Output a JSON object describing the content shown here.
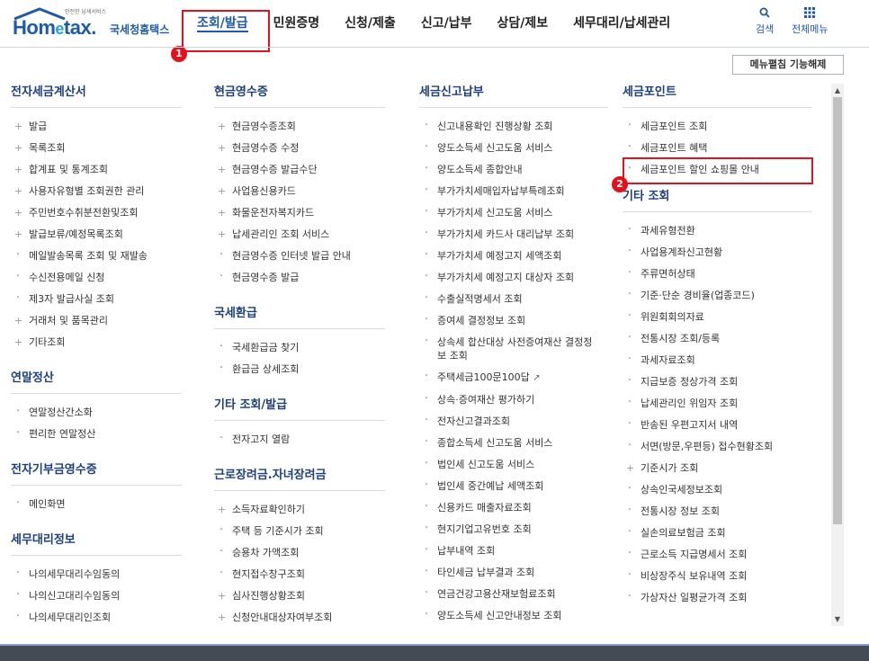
{
  "logo": {
    "small_text": "안전한 납세서비스",
    "home_text_a": "Hom",
    "home_text_e": "e",
    "home_text_b": "tax.",
    "site_name": "국세청홈택스"
  },
  "gnb": [
    "조회/발급",
    "민원증명",
    "신청/제출",
    "신고/납부",
    "상담/제보",
    "세무대리/납세관리"
  ],
  "util": {
    "search_label": "검색",
    "all_menu_label": "전체메뉴"
  },
  "badges": {
    "b1": "1",
    "b2": "2"
  },
  "menu_toggle": "메뉴펼침 기능해제",
  "columns": {
    "c1": [
      {
        "title": "전자세금계산서",
        "items": [
          "발급",
          "목록조회",
          "합계표 및 통계조회",
          "사용자유형별 조회권한 관리",
          "주민번호수취분전환및조회",
          "발급보류/예정목록조회",
          "메일발송목록 조회 및 재발송",
          "수신전용메일 신청",
          "제3자 발급사실 조회",
          "거래처 및 품목관리",
          "기타조회"
        ]
      },
      {
        "title": "연말정산",
        "items": [
          "연말정산간소화",
          "편리한 연말정산"
        ]
      },
      {
        "title": "전자기부금영수증",
        "items": [
          "메인화면"
        ]
      },
      {
        "title": "세무대리정보",
        "items": [
          "나의세무대리수임동의",
          "나의신고대리수임동의",
          "나의세무대리인조회"
        ]
      }
    ],
    "c2": [
      {
        "title": "현금영수증",
        "items": [
          "현금영수증조회",
          "현금영수증 수정",
          "현금영수증 발급수단",
          "사업용신용카드",
          "화물운전자복지카드",
          "납세관리인 조회 서비스",
          "현금영수증 인터넷 발급 안내",
          "현금영수증 발급"
        ]
      },
      {
        "title": "국세환급",
        "items": [
          "국세환급금 찾기",
          "환급금 상세조회"
        ]
      },
      {
        "title": "기타 조회/발급",
        "items": [
          "전자고지 열람"
        ]
      },
      {
        "title": "근로장려금.자녀장려금",
        "items": [
          "소득자료확인하기",
          "주택 등 기준시가 조회",
          "승용차 가액조회",
          "현지접수창구조회",
          "심사진행상황조회",
          "신청안내대상자여부조회"
        ]
      }
    ],
    "c3": [
      {
        "title": "세금신고납부",
        "items": [
          "신고내용확인 진행상황 조회",
          "양도소득세 신고도움 서비스",
          "양도소득세 종합안내",
          "부가가치세매입자납부특례조회",
          "부가가치세 신고도움 서비스",
          "부가가치세 카드사 대리납부 조회",
          "부가가치세 예정고지 세액조회",
          "부가가치세 예정고지 대상자 조회",
          "수출실적명세서 조회",
          "증여세 결정정보 조회",
          "상속세 합산대상 사전증여재산 결정정보 조회",
          "주택세금100문100답",
          "상속·증여재산 평가하기",
          "전자신고결과조회",
          "종합소득세 신고도움 서비스",
          "법인세 신고도움 서비스",
          "법인세 중간예납 세액조회",
          "신용카드 매출자료조회",
          "현지기업고유번호 조회",
          "납부내역 조회",
          "타인세금 납부결과 조회",
          "연금건강고용산재보험료조회",
          "양도소득세 신고안내정보 조회"
        ]
      }
    ],
    "c4": [
      {
        "title": "세금포인트",
        "items": [
          "세금포인트 조회",
          "세금포인트 혜택",
          "세금포인트 할인 쇼핑몰 안내"
        ]
      },
      {
        "title": "기타 조회",
        "items": [
          "과세유형전환",
          "사업용계좌신고현황",
          "주류면허상태",
          "기준·단순 경비율(업종코드)",
          "위원회회의자료",
          "전통시장 조회/등록",
          "과세자료조회",
          "지급보증 정상가격 조회",
          "납세관리인 위임자 조회",
          "반송된 우편고지서 내역",
          "서면(방문,우편등) 접수현황조회",
          "기준시가 조회",
          "상속인국세정보조회",
          "전통시장 정보 조회",
          "실손의료보험금 조회",
          "근로소득 지급명세서 조회",
          "비상장주식 보유내역 조회",
          "가상자산 일평균가격 조회"
        ]
      }
    ]
  },
  "colors": {
    "brand": "#1e5aa8",
    "highlight": "#e3111b",
    "section_title": "#1d3f7a"
  }
}
